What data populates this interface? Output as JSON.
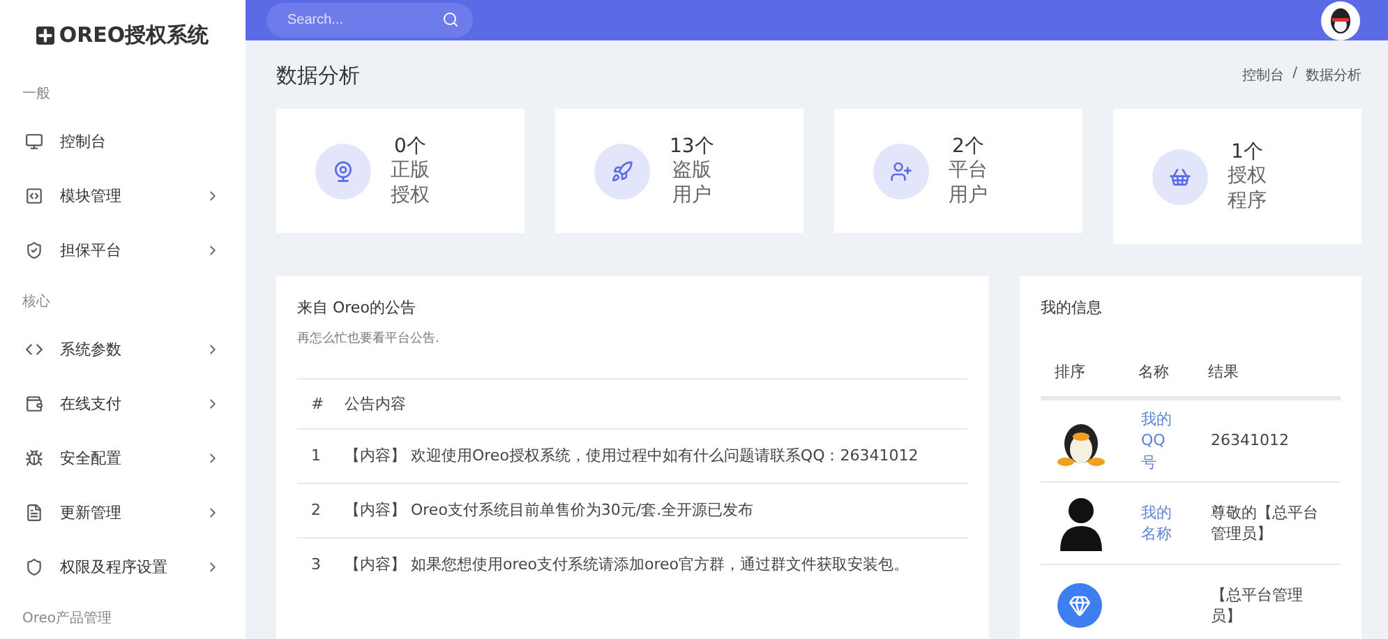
{
  "brand": {
    "name": "OREO授权系统"
  },
  "search": {
    "placeholder": "Search..."
  },
  "sidebar": {
    "sections": [
      {
        "title": "一般",
        "items": [
          {
            "label": "控制台",
            "expandable": false
          },
          {
            "label": "模块管理",
            "expandable": true
          },
          {
            "label": "担保平台",
            "expandable": true
          }
        ]
      },
      {
        "title": "核心",
        "items": [
          {
            "label": "系统参数",
            "expandable": true
          },
          {
            "label": "在线支付",
            "expandable": true
          },
          {
            "label": "安全配置",
            "expandable": true
          },
          {
            "label": "更新管理",
            "expandable": true
          },
          {
            "label": "权限及程序设置",
            "expandable": true
          }
        ]
      },
      {
        "title": "Oreo产品管理"
      }
    ]
  },
  "page": {
    "title": "数据分析",
    "breadcrumb": {
      "items": [
        "控制台",
        "数据分析"
      ],
      "separator": "/"
    }
  },
  "stats": [
    {
      "count": "0个",
      "label": "正版授权"
    },
    {
      "count": "13个",
      "label": "盗版用户"
    },
    {
      "count": "2个",
      "label": "平台用户"
    },
    {
      "count": "1个",
      "label": "授权程序"
    }
  ],
  "notice": {
    "title": "来自 Oreo的公告",
    "subtitle": "再怎么忙也要看平台公告.",
    "columns": [
      "#",
      "公告内容"
    ],
    "rows": [
      {
        "num": "1",
        "text": "【内容】 欢迎使用Oreo授权系统，使用过程中如有什么问题请联系QQ：26341012"
      },
      {
        "num": "2",
        "text": "【内容】 Oreo支付系统目前单售价为30元/套.全开源已发布"
      },
      {
        "num": "3",
        "text": "【内容】 如果您想使用oreo支付系统请添加oreo官方群，通过群文件获取安装包。"
      }
    ]
  },
  "info": {
    "title": "我的信息",
    "columns": [
      "排序",
      "名称",
      "结果"
    ],
    "rows": [
      {
        "kind": "penguin",
        "name": "我的QQ号",
        "result": "26341012"
      },
      {
        "kind": "person",
        "name": "我的名称",
        "result": "尊敬的【总平台管理员】"
      },
      {
        "kind": "diamond",
        "result": "【总平台管理员】"
      }
    ]
  }
}
